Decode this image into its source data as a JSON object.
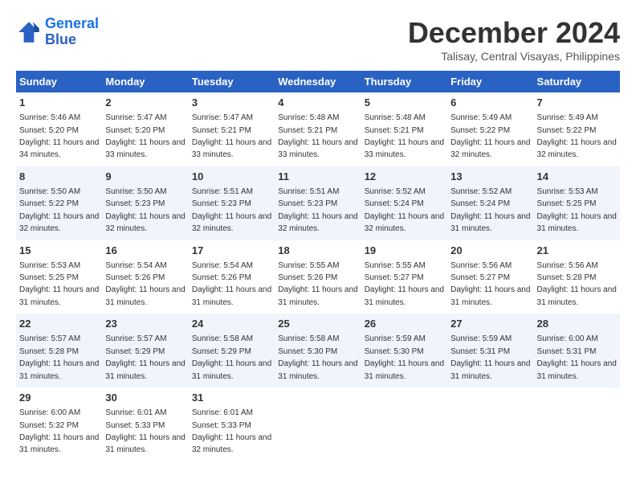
{
  "logo": {
    "line1": "General",
    "line2": "Blue"
  },
  "title": "December 2024",
  "location": "Talisay, Central Visayas, Philippines",
  "headers": [
    "Sunday",
    "Monday",
    "Tuesday",
    "Wednesday",
    "Thursday",
    "Friday",
    "Saturday"
  ],
  "weeks": [
    [
      {
        "day": "1",
        "sunrise": "Sunrise: 5:46 AM",
        "sunset": "Sunset: 5:20 PM",
        "daylight": "Daylight: 11 hours and 34 minutes."
      },
      {
        "day": "2",
        "sunrise": "Sunrise: 5:47 AM",
        "sunset": "Sunset: 5:20 PM",
        "daylight": "Daylight: 11 hours and 33 minutes."
      },
      {
        "day": "3",
        "sunrise": "Sunrise: 5:47 AM",
        "sunset": "Sunset: 5:21 PM",
        "daylight": "Daylight: 11 hours and 33 minutes."
      },
      {
        "day": "4",
        "sunrise": "Sunrise: 5:48 AM",
        "sunset": "Sunset: 5:21 PM",
        "daylight": "Daylight: 11 hours and 33 minutes."
      },
      {
        "day": "5",
        "sunrise": "Sunrise: 5:48 AM",
        "sunset": "Sunset: 5:21 PM",
        "daylight": "Daylight: 11 hours and 33 minutes."
      },
      {
        "day": "6",
        "sunrise": "Sunrise: 5:49 AM",
        "sunset": "Sunset: 5:22 PM",
        "daylight": "Daylight: 11 hours and 32 minutes."
      },
      {
        "day": "7",
        "sunrise": "Sunrise: 5:49 AM",
        "sunset": "Sunset: 5:22 PM",
        "daylight": "Daylight: 11 hours and 32 minutes."
      }
    ],
    [
      {
        "day": "8",
        "sunrise": "Sunrise: 5:50 AM",
        "sunset": "Sunset: 5:22 PM",
        "daylight": "Daylight: 11 hours and 32 minutes."
      },
      {
        "day": "9",
        "sunrise": "Sunrise: 5:50 AM",
        "sunset": "Sunset: 5:23 PM",
        "daylight": "Daylight: 11 hours and 32 minutes."
      },
      {
        "day": "10",
        "sunrise": "Sunrise: 5:51 AM",
        "sunset": "Sunset: 5:23 PM",
        "daylight": "Daylight: 11 hours and 32 minutes."
      },
      {
        "day": "11",
        "sunrise": "Sunrise: 5:51 AM",
        "sunset": "Sunset: 5:23 PM",
        "daylight": "Daylight: 11 hours and 32 minutes."
      },
      {
        "day": "12",
        "sunrise": "Sunrise: 5:52 AM",
        "sunset": "Sunset: 5:24 PM",
        "daylight": "Daylight: 11 hours and 32 minutes."
      },
      {
        "day": "13",
        "sunrise": "Sunrise: 5:52 AM",
        "sunset": "Sunset: 5:24 PM",
        "daylight": "Daylight: 11 hours and 31 minutes."
      },
      {
        "day": "14",
        "sunrise": "Sunrise: 5:53 AM",
        "sunset": "Sunset: 5:25 PM",
        "daylight": "Daylight: 11 hours and 31 minutes."
      }
    ],
    [
      {
        "day": "15",
        "sunrise": "Sunrise: 5:53 AM",
        "sunset": "Sunset: 5:25 PM",
        "daylight": "Daylight: 11 hours and 31 minutes."
      },
      {
        "day": "16",
        "sunrise": "Sunrise: 5:54 AM",
        "sunset": "Sunset: 5:26 PM",
        "daylight": "Daylight: 11 hours and 31 minutes."
      },
      {
        "day": "17",
        "sunrise": "Sunrise: 5:54 AM",
        "sunset": "Sunset: 5:26 PM",
        "daylight": "Daylight: 11 hours and 31 minutes."
      },
      {
        "day": "18",
        "sunrise": "Sunrise: 5:55 AM",
        "sunset": "Sunset: 5:26 PM",
        "daylight": "Daylight: 11 hours and 31 minutes."
      },
      {
        "day": "19",
        "sunrise": "Sunrise: 5:55 AM",
        "sunset": "Sunset: 5:27 PM",
        "daylight": "Daylight: 11 hours and 31 minutes."
      },
      {
        "day": "20",
        "sunrise": "Sunrise: 5:56 AM",
        "sunset": "Sunset: 5:27 PM",
        "daylight": "Daylight: 11 hours and 31 minutes."
      },
      {
        "day": "21",
        "sunrise": "Sunrise: 5:56 AM",
        "sunset": "Sunset: 5:28 PM",
        "daylight": "Daylight: 11 hours and 31 minutes."
      }
    ],
    [
      {
        "day": "22",
        "sunrise": "Sunrise: 5:57 AM",
        "sunset": "Sunset: 5:28 PM",
        "daylight": "Daylight: 11 hours and 31 minutes."
      },
      {
        "day": "23",
        "sunrise": "Sunrise: 5:57 AM",
        "sunset": "Sunset: 5:29 PM",
        "daylight": "Daylight: 11 hours and 31 minutes."
      },
      {
        "day": "24",
        "sunrise": "Sunrise: 5:58 AM",
        "sunset": "Sunset: 5:29 PM",
        "daylight": "Daylight: 11 hours and 31 minutes."
      },
      {
        "day": "25",
        "sunrise": "Sunrise: 5:58 AM",
        "sunset": "Sunset: 5:30 PM",
        "daylight": "Daylight: 11 hours and 31 minutes."
      },
      {
        "day": "26",
        "sunrise": "Sunrise: 5:59 AM",
        "sunset": "Sunset: 5:30 PM",
        "daylight": "Daylight: 11 hours and 31 minutes."
      },
      {
        "day": "27",
        "sunrise": "Sunrise: 5:59 AM",
        "sunset": "Sunset: 5:31 PM",
        "daylight": "Daylight: 11 hours and 31 minutes."
      },
      {
        "day": "28",
        "sunrise": "Sunrise: 6:00 AM",
        "sunset": "Sunset: 5:31 PM",
        "daylight": "Daylight: 11 hours and 31 minutes."
      }
    ],
    [
      {
        "day": "29",
        "sunrise": "Sunrise: 6:00 AM",
        "sunset": "Sunset: 5:32 PM",
        "daylight": "Daylight: 11 hours and 31 minutes."
      },
      {
        "day": "30",
        "sunrise": "Sunrise: 6:01 AM",
        "sunset": "Sunset: 5:33 PM",
        "daylight": "Daylight: 11 hours and 31 minutes."
      },
      {
        "day": "31",
        "sunrise": "Sunrise: 6:01 AM",
        "sunset": "Sunset: 5:33 PM",
        "daylight": "Daylight: 11 hours and 32 minutes."
      },
      {
        "day": "",
        "sunrise": "",
        "sunset": "",
        "daylight": ""
      },
      {
        "day": "",
        "sunrise": "",
        "sunset": "",
        "daylight": ""
      },
      {
        "day": "",
        "sunrise": "",
        "sunset": "",
        "daylight": ""
      },
      {
        "day": "",
        "sunrise": "",
        "sunset": "",
        "daylight": ""
      }
    ]
  ]
}
